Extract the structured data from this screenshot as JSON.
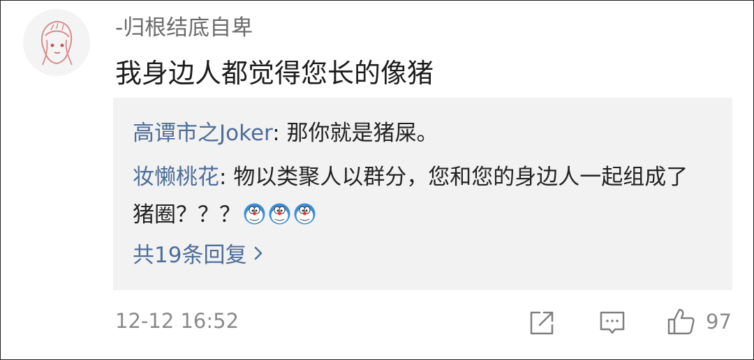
{
  "comment": {
    "username": "-归根结底自卑",
    "text": "我身边人都觉得您长的像猪",
    "time": "12-12 16:52",
    "likes": "97"
  },
  "replies": [
    {
      "name": "高谭市之Joker",
      "sep": ": ",
      "text": "那你就是猪屎。"
    },
    {
      "name": "妆懒桃花",
      "sep": ": ",
      "text": "物以类聚人以群分，您和您的身边人一起组成了猪圈？？？"
    }
  ],
  "more_replies": "共19条回复",
  "icons": {
    "avatar": "avatar",
    "emoji": "doraemon-emoji",
    "chevron": "chevron-right-icon",
    "share": "share-icon",
    "comment": "comment-icon",
    "like": "thumbs-up-icon"
  },
  "colors": {
    "link": "#4d6e99",
    "text": "#1c1c1c",
    "meta": "#8a8a8a",
    "reply_bg": "#f2f2f2"
  }
}
